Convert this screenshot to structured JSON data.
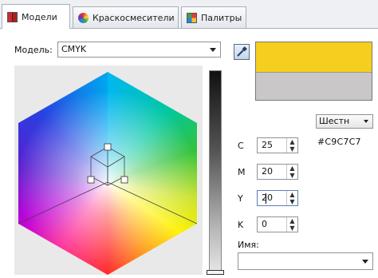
{
  "tabs": [
    {
      "label": "Модели",
      "icon": "models-icon",
      "active": true
    },
    {
      "label": "Краскосмесители",
      "icon": "color-mixers-icon",
      "active": false
    },
    {
      "label": "Палитры",
      "icon": "palettes-icon",
      "active": false
    }
  ],
  "model": {
    "label": "Модель:",
    "value": "CMYK"
  },
  "swatch": {
    "new_color": "#f6cf1e",
    "old_color": "#c9c7c7"
  },
  "format_button": {
    "label": "Шестн"
  },
  "components": [
    {
      "label": "C",
      "value": "25"
    },
    {
      "label": "M",
      "value": "20"
    },
    {
      "label": "Y",
      "value": "20"
    },
    {
      "label": "K",
      "value": "0"
    }
  ],
  "hex_value": "#C9C7C7",
  "name": {
    "label": "Имя:",
    "value": ""
  }
}
